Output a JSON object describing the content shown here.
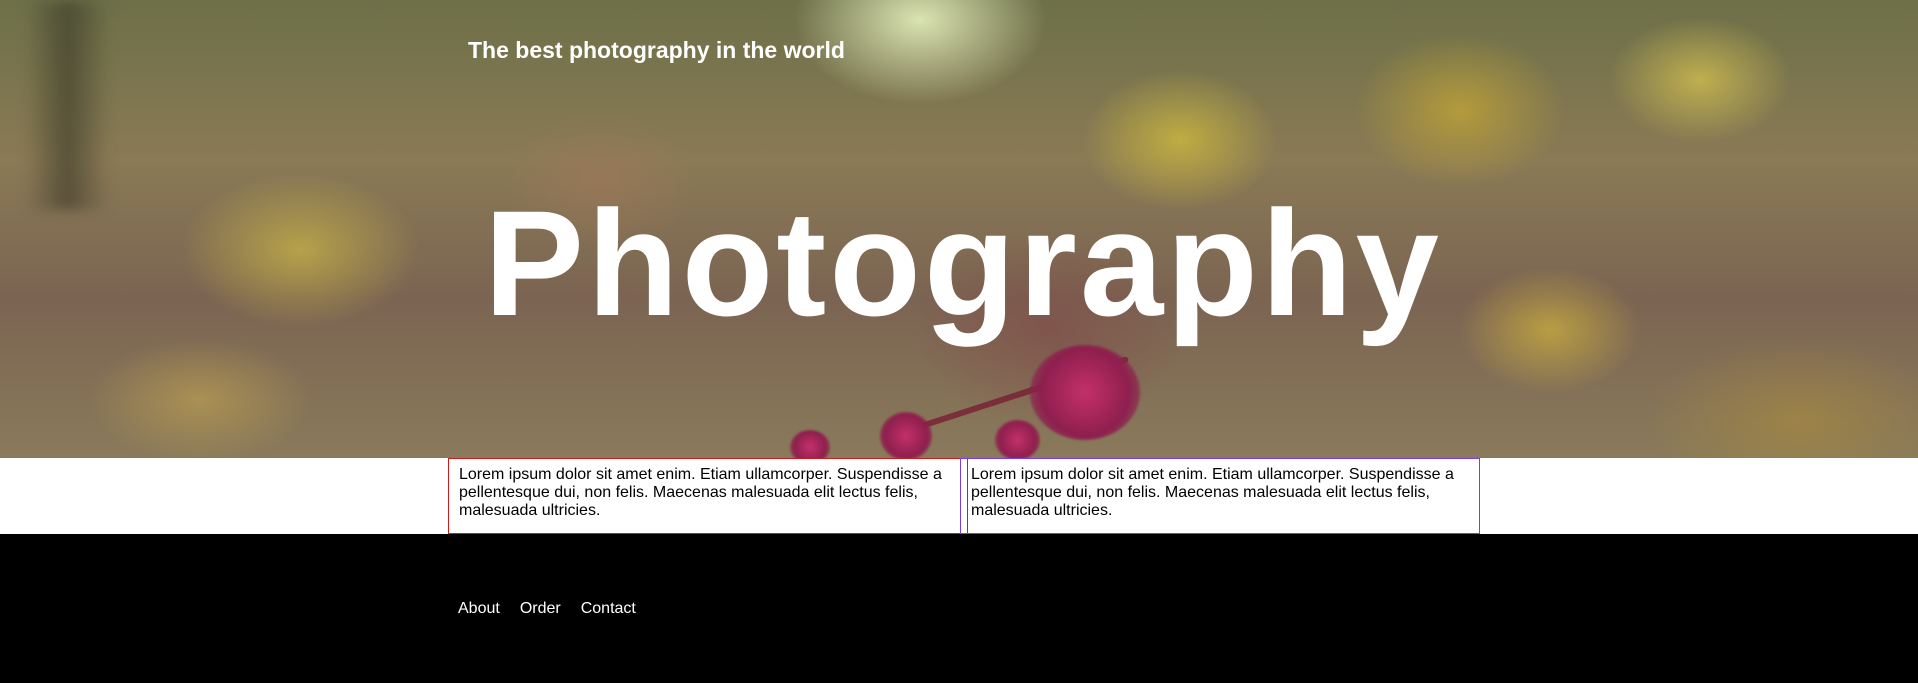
{
  "header": {
    "tagline": "The best photography in the world",
    "headline": "Photography"
  },
  "content": {
    "left_box_text": "Lorem ipsum dolor sit amet enim. Etiam ullamcorper. Suspendisse a pellentesque dui, non felis. Maecenas malesuada elit lectus felis, malesuada ultricies.",
    "right_box_text": "Lorem ipsum dolor sit amet enim. Etiam ullamcorper. Suspendisse a pellentesque dui, non felis. Maecenas malesuada elit lectus felis, malesuada ultricies."
  },
  "footer": {
    "nav": [
      {
        "label": "About"
      },
      {
        "label": "Order"
      },
      {
        "label": "Contact"
      }
    ]
  },
  "colors": {
    "left_box_border": "#d21a1a",
    "right_box_border": "#7a3cf0",
    "footer_background": "#000000",
    "text_light": "#ffffff"
  }
}
